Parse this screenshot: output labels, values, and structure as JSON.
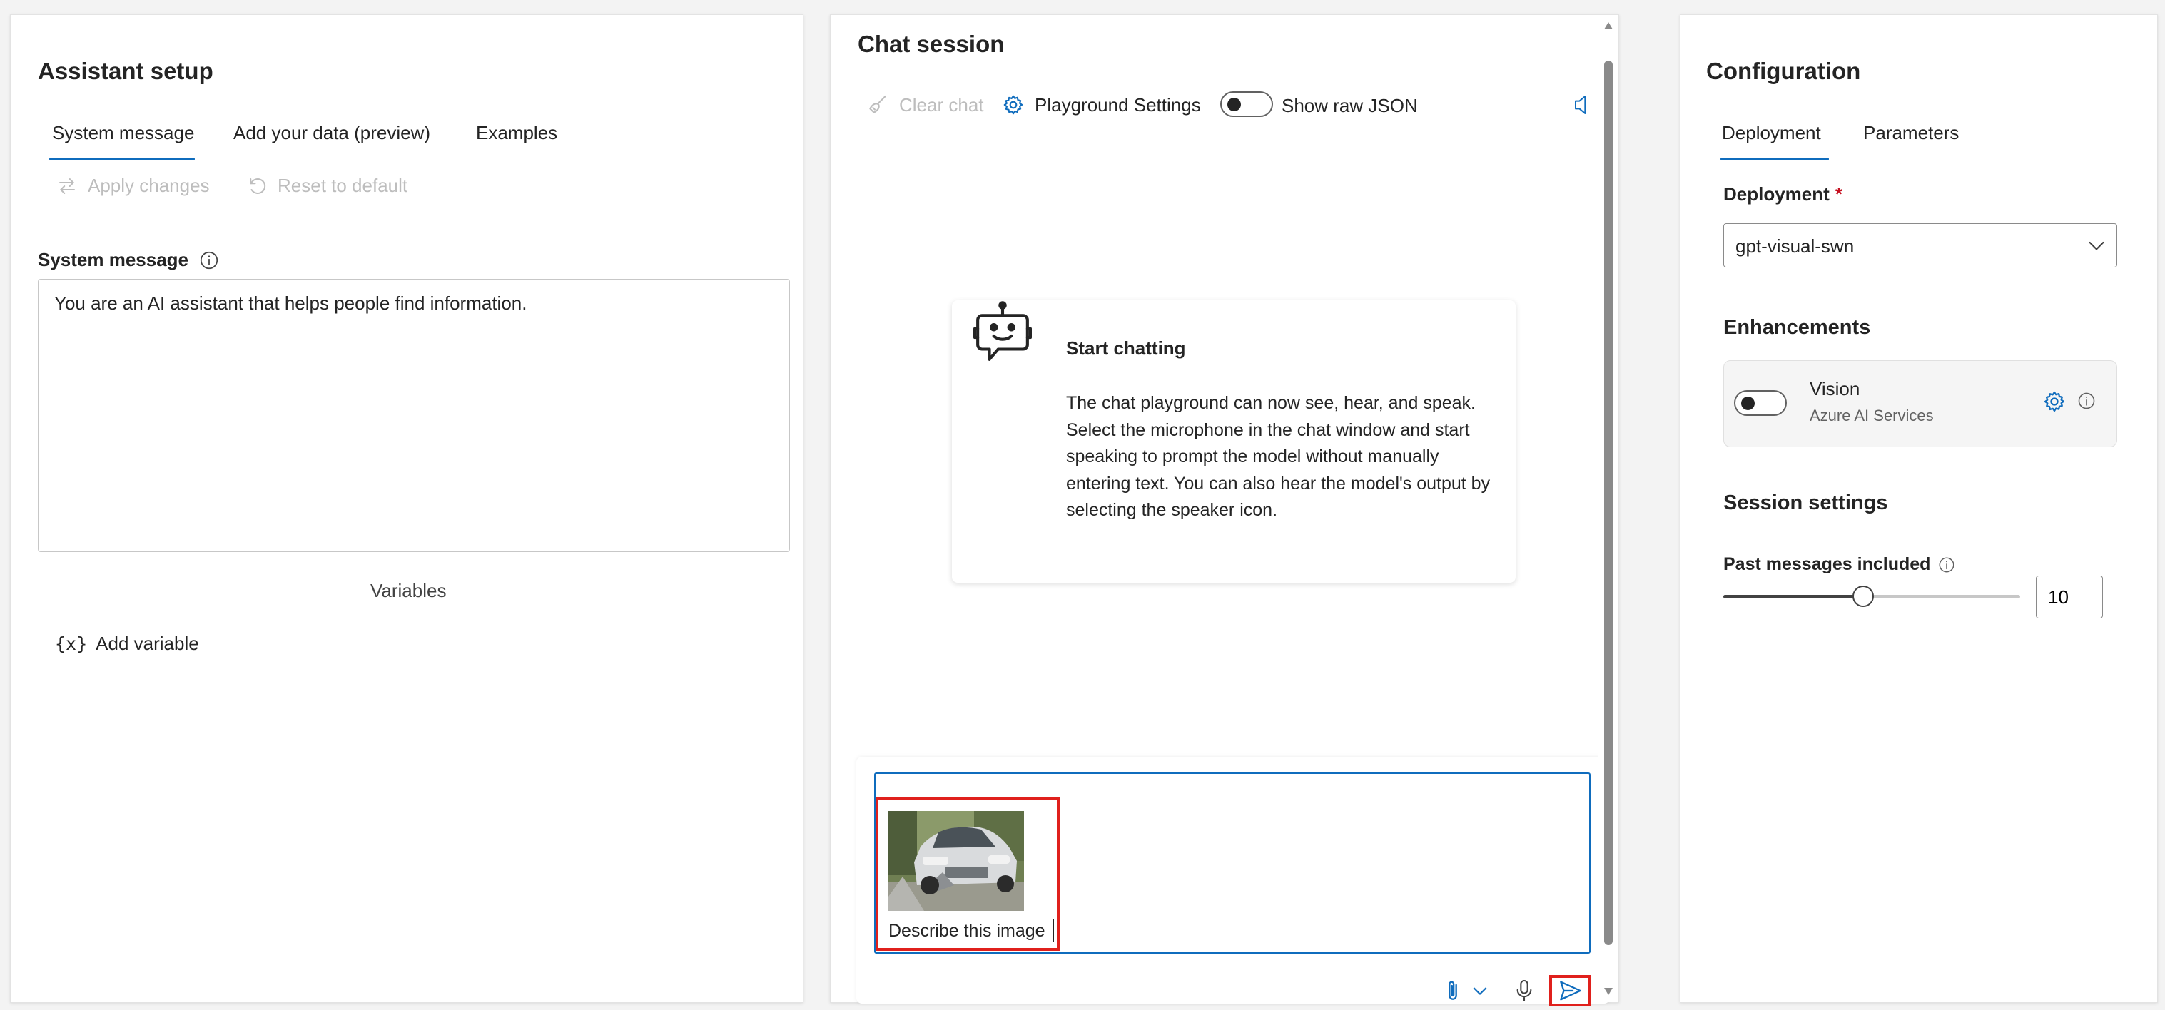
{
  "assistant_setup": {
    "title": "Assistant setup",
    "tabs": [
      {
        "label": "System message"
      },
      {
        "label": "Add your data (preview)"
      },
      {
        "label": "Examples"
      }
    ],
    "apply_changes_label": "Apply changes",
    "reset_label": "Reset to default",
    "system_message_label": "System message",
    "system_message_value": "You are an AI assistant that helps people find information.",
    "variables_heading": "Variables",
    "add_variable_icon_text": "{x}",
    "add_variable_label": "Add variable"
  },
  "chat_session": {
    "title": "Chat session",
    "clear_chat_label": "Clear chat",
    "playground_settings_label": "Playground Settings",
    "show_raw_json_label": "Show raw JSON",
    "show_raw_json_on": false,
    "start_card": {
      "title": "Start chatting",
      "body": "The chat playground can now see, hear, and speak. Select the microphone in the chat window and start speaking to prompt the model without manually entering text. You can also hear the model's output by selecting the speaker icon."
    },
    "composer": {
      "attachment_icon": "car-photo-thumbnail",
      "input_text": "Describe this image"
    }
  },
  "configuration": {
    "title": "Configuration",
    "tabs": [
      {
        "label": "Deployment"
      },
      {
        "label": "Parameters"
      }
    ],
    "deployment_label": "Deployment",
    "required_mark": "*",
    "deployment_value": "gpt-visual-swn",
    "enhancements_heading": "Enhancements",
    "vision": {
      "title": "Vision",
      "subtitle": "Azure AI Services",
      "enabled": false
    },
    "session_settings_heading": "Session settings",
    "past_messages_label": "Past messages included",
    "past_messages_value": "10",
    "past_messages_slider_fraction": 0.47
  },
  "colors": {
    "accent": "#0f6cbd",
    "highlight_red": "#e0201c"
  }
}
